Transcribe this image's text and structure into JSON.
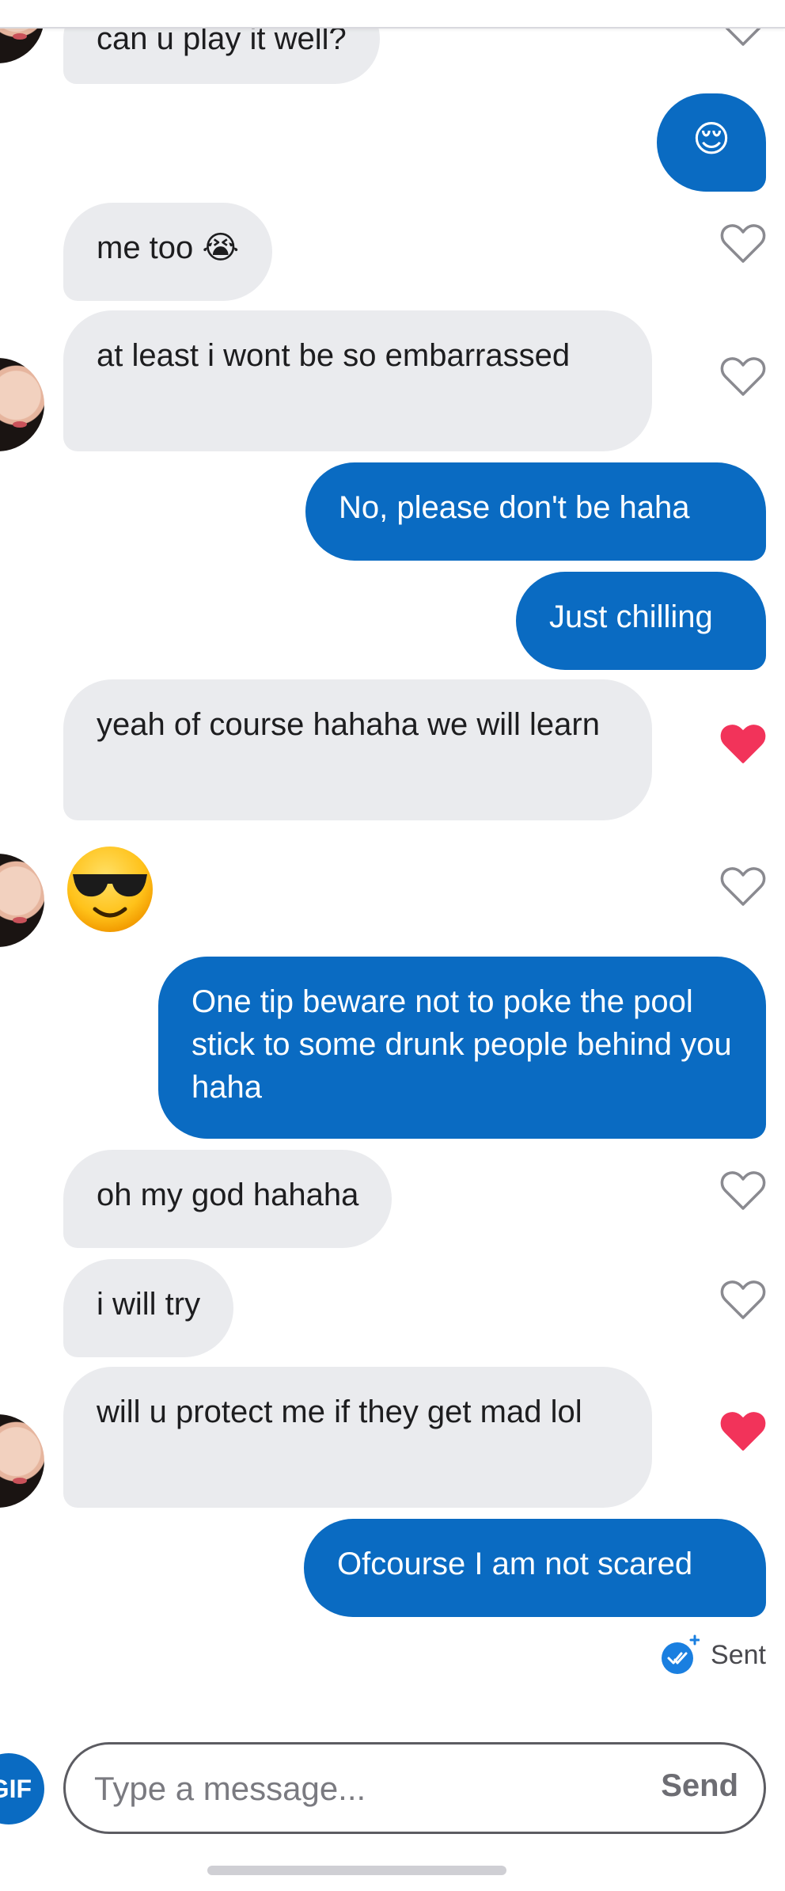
{
  "messages": [
    {
      "side": "recv",
      "text": "can u play it well?",
      "heart": "outline",
      "avatar": true
    },
    {
      "side": "sent",
      "text": "😌"
    },
    {
      "side": "recv",
      "text": "me too 😭",
      "heart": "outline"
    },
    {
      "side": "recv",
      "text": "at least i wont be so embarrassed",
      "heart": "outline",
      "avatar": true
    },
    {
      "side": "sent",
      "text": "No, please don't be haha"
    },
    {
      "side": "sent",
      "text": "Just chilling"
    },
    {
      "side": "recv",
      "text": "yeah of course hahaha we will learn",
      "heart": "filled"
    },
    {
      "side": "recv",
      "text": "😎",
      "heart": "outline",
      "avatar": true,
      "emoji_only": true
    },
    {
      "side": "sent",
      "text": "One tip beware not to poke the pool stick to some drunk people behind you haha"
    },
    {
      "side": "recv",
      "text": "oh my god hahaha",
      "heart": "outline"
    },
    {
      "side": "recv",
      "text": "i will try",
      "heart": "outline"
    },
    {
      "side": "recv",
      "text": "will u protect me if they get mad lol",
      "heart": "filled",
      "avatar": true
    },
    {
      "side": "sent",
      "text": "Ofcourse I am not scared"
    }
  ],
  "status": {
    "label": "Sent",
    "icon": "double-check-icon"
  },
  "composer": {
    "gif_label": "GIF",
    "placeholder": "Type a message...",
    "send_label": "Send"
  },
  "colors": {
    "sent_bubble": "#0a6bc2",
    "recv_bubble": "#eaebee",
    "heart_filled": "#f2335a",
    "heart_outline": "#8a8a90"
  }
}
